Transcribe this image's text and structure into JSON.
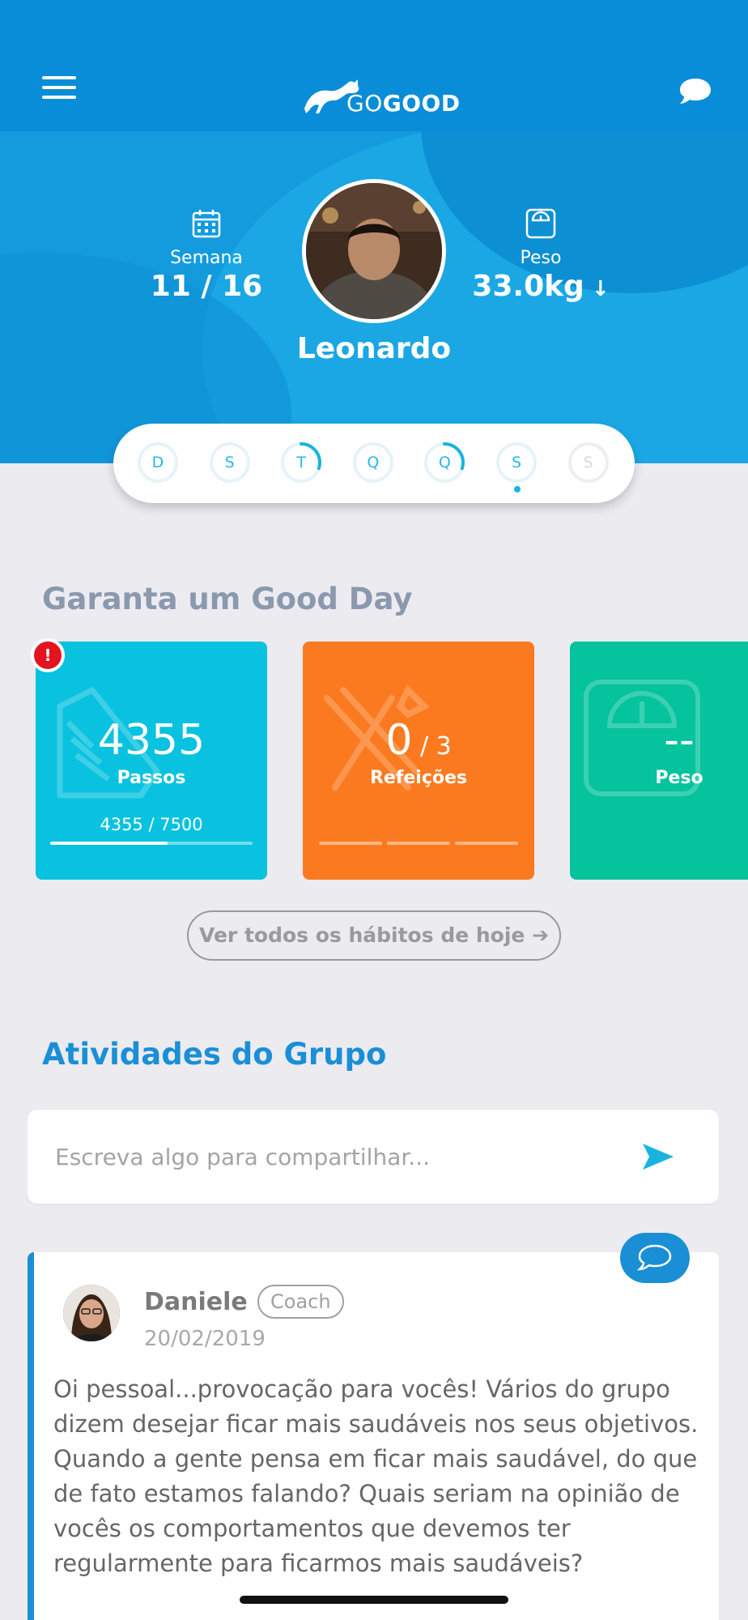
{
  "app": {
    "logo_go": "GO",
    "logo_good": "GOOD"
  },
  "header": {
    "menu_icon": "hamburger-menu-icon",
    "chat_icon": "chat-bubble-icon"
  },
  "profile": {
    "name": "Leonardo",
    "week_label": "Semana",
    "week_value": "11 / 16",
    "weight_label": "Peso",
    "weight_value": "33.0kg",
    "weight_trend_icon": "arrow-down-icon"
  },
  "weekdays": [
    {
      "letter": "D",
      "progress": 0
    },
    {
      "letter": "S",
      "progress": 0
    },
    {
      "letter": "T",
      "progress": 0.3
    },
    {
      "letter": "Q",
      "progress": 0
    },
    {
      "letter": "Q",
      "progress": 0.3
    },
    {
      "letter": "S",
      "progress": 0,
      "selected": true
    },
    {
      "letter": "S",
      "progress": 0,
      "future": true
    }
  ],
  "good_day": {
    "title": "Garanta um Good Day",
    "alert": "!",
    "cards": [
      {
        "value": "4355",
        "label": "Passos",
        "progress_text": "4355 / 7500",
        "progress": 0.58,
        "color": "#08c2e0",
        "icon": "shoe-icon"
      },
      {
        "value": "0",
        "value_sub": " / 3",
        "label": "Refeições",
        "progress": 0,
        "color": "#fb7a1f",
        "icon": "fork-knife-icon"
      },
      {
        "value": "--",
        "label": "Peso",
        "color": "#05c39c",
        "icon": "scale-icon"
      }
    ],
    "see_all": "Ver todos os hábitos de hoje ➔"
  },
  "group": {
    "title": "Atividades do Grupo",
    "share_placeholder": "Escreva algo para compartilhar...",
    "post": {
      "author": "Daniele",
      "role": "Coach",
      "date": "20/02/2019",
      "text": "Oi pessoal...provocação para vocês! Vários do grupo dizem desejar ficar mais saudáveis nos seus objetivos.\nQuando a gente pensa em ficar mais saudável, do que de fato estamos falando? Quais seriam na opinião de vocês os comportamentos que devemos ter regularmente para ficarmos mais saudáveis?"
    }
  },
  "colors": {
    "primary": "#0a8dd8",
    "accent": "#1ab3e0",
    "steps": "#08c2e0",
    "meals": "#fb7a1f",
    "weight": "#05c39c",
    "alert": "#e4141f"
  }
}
